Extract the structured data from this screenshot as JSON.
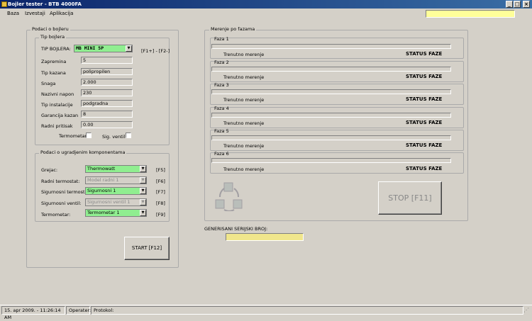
{
  "window": {
    "title": "Bojler tester - BTB 4000FA"
  },
  "menu": [
    "Baza",
    "Izvestaji",
    "Aplikacija"
  ],
  "left_panel": {
    "title": "Podaci o bojleru",
    "boiler_group": {
      "title": "Tip bojlera",
      "type_label": "TIP BOJLERA:",
      "type_value": "MB MINI 5P",
      "type_hint": "[F1+] - [F2-]",
      "fields": [
        {
          "label": "Zapremina",
          "value": "5"
        },
        {
          "label": "Tip kazana",
          "value": "polipropilen"
        },
        {
          "label": "Snaga",
          "value": "2.000"
        },
        {
          "label": "Nazivni napon",
          "value": "230"
        },
        {
          "label": "Tip instalacije",
          "value": "podgradna"
        },
        {
          "label": "Garancija kazan",
          "value": "8"
        },
        {
          "label": "Radni pritisak",
          "value": "0.00"
        }
      ],
      "checkboxes": [
        {
          "label": "Termometar"
        },
        {
          "label": "Sig. ventil"
        }
      ]
    },
    "components_group": {
      "title": "Podaci o ugradjenim komponentama",
      "rows": [
        {
          "label": "Grejac:",
          "value": "Thermowatt",
          "key": "[F5]",
          "enabled": true
        },
        {
          "label": "Radni termostat:",
          "value": "Model radni 1",
          "key": "[F6]",
          "enabled": false
        },
        {
          "label": "Sigurnosni termostat:",
          "value": "Sigurnosni 1",
          "key": "[F7]",
          "enabled": true
        },
        {
          "label": "Sigurnosni ventil:",
          "value": "Sigurnosni ventil 1",
          "key": "[F8]",
          "enabled": false
        },
        {
          "label": "Termometar:",
          "value": "Termometar 1",
          "key": "[F9]",
          "enabled": true
        }
      ]
    },
    "start_button": "START [F12]"
  },
  "right_panel": {
    "title": "Merenje po fazama",
    "phases": [
      {
        "name": "Faza 1",
        "measure_label": "Trenutno merenje",
        "status": "STATUS FAZE"
      },
      {
        "name": "Faza 2",
        "measure_label": "Trenutno merenje",
        "status": "STATUS FAZE"
      },
      {
        "name": "Faza 3",
        "measure_label": "Trenutno merenje",
        "status": "STATUS FAZE"
      },
      {
        "name": "Faza 4",
        "measure_label": "Trenutno merenje",
        "status": "STATUS FAZE"
      },
      {
        "name": "Faza 5",
        "measure_label": "Trenutno merenje",
        "status": "STATUS FAZE"
      },
      {
        "name": "Faza 6",
        "measure_label": "Trenutno merenje",
        "status": "STATUS FAZE"
      }
    ],
    "stop_button": "STOP [F11]",
    "serial_label": "GENERISANI SERIJSKI BROJ:",
    "serial_value": ""
  },
  "statusbar": {
    "datetime": "15. apr 2009. - 11:26:14 AM",
    "operator": "Operater:",
    "protocol": "Protokol:"
  },
  "colors": {
    "title_bar": "#0a246a",
    "combo_green": "#90ee90",
    "input_yellow": "#ffff99"
  },
  "icons": [
    "app-icon",
    "minimize-icon",
    "maximize-icon",
    "close-icon",
    "recycle-cubes-icon"
  ]
}
